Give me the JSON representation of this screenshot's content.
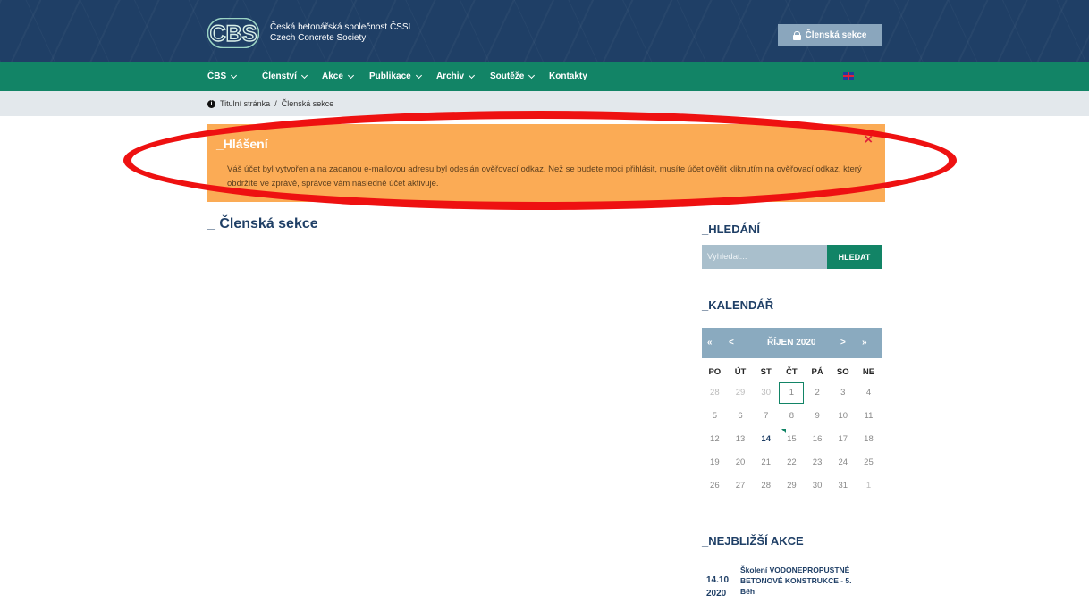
{
  "header": {
    "brand_line1": "Česká betonářská společnost ČSSI",
    "brand_line2": "Czech Concrete Society",
    "member_button": "Členská sekce",
    "logo_text": "CBS"
  },
  "nav": {
    "items": [
      {
        "label": "ČBS",
        "dropdown": true
      },
      {
        "label": "Členství",
        "dropdown": true
      },
      {
        "label": "Akce",
        "dropdown": true
      },
      {
        "label": "Publikace",
        "dropdown": true
      },
      {
        "label": "Archiv",
        "dropdown": true
      },
      {
        "label": "Soutěže",
        "dropdown": true
      },
      {
        "label": "Kontakty",
        "dropdown": false
      }
    ],
    "language_icon": "uk-flag-icon"
  },
  "breadcrumb": {
    "home": "Titulní stránka",
    "separator": "/",
    "current": "Členská sekce"
  },
  "notice": {
    "title": "_Hlášení",
    "close": "×",
    "text": "Váš účet byl vytvořen a na zadanou e-mailovou adresu byl odeslán ověřovací odkaz. Než se budete moci přihlásit, musíte účet ověřit kliknutím na ověřovací odkaz, který obdržíte ve zprávě, správce vám následně účet aktivuje."
  },
  "main": {
    "title": "_ Členská sekce"
  },
  "search": {
    "heading": "_HLEDÁNÍ",
    "placeholder": "Vyhledat...",
    "button": "HLEDAT"
  },
  "calendar": {
    "heading": "_KALENDÁŘ",
    "prev_year": "«",
    "prev_month": "<",
    "month": "ŘÍJEN 2020",
    "next_month": ">",
    "next_year": "»",
    "days_of_week": [
      "PO",
      "ÚT",
      "ST",
      "ČT",
      "PÁ",
      "SO",
      "NE"
    ],
    "weeks": [
      [
        "28",
        "29",
        "30",
        "1",
        "2",
        "3",
        "4"
      ],
      [
        "5",
        "6",
        "7",
        "8",
        "9",
        "10",
        "11"
      ],
      [
        "12",
        "13",
        "14",
        "15",
        "16",
        "17",
        "18"
      ],
      [
        "19",
        "20",
        "21",
        "22",
        "23",
        "24",
        "25"
      ],
      [
        "26",
        "27",
        "28",
        "29",
        "30",
        "31",
        "1"
      ]
    ]
  },
  "events": {
    "heading": "_NEJBLIŽŠÍ AKCE",
    "items": [
      {
        "date_day": "14.10",
        "date_year": "2020",
        "title": "Školení VODONEPROPUSTNÉ BETONOVÉ KONSTRUKCE - 5. Běh"
      }
    ]
  },
  "colors": {
    "header": "#1f3f66",
    "nav": "#128466",
    "notice": "#fbab55",
    "highlight": "#ee1111"
  }
}
